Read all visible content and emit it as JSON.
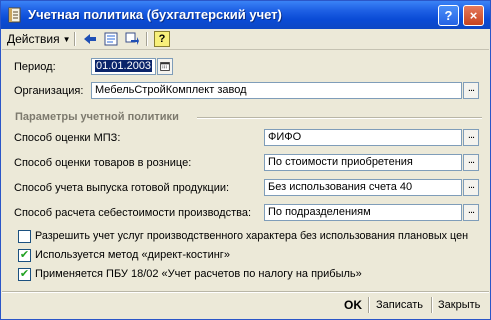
{
  "window": {
    "title": "Учетная политика (бухгалтерский учет)",
    "help_label": "?",
    "close_label": "×"
  },
  "toolbar": {
    "actions_label": "Действия",
    "help_label": "?"
  },
  "form": {
    "period_label": "Период:",
    "period_value": "01.01.2003",
    "org_label": "Организация:",
    "org_value": "МебельСтройКомплект завод",
    "section_title": "Параметры учетной политики",
    "rows": [
      {
        "label": "Способ оценки МПЗ:",
        "value": "ФИФО"
      },
      {
        "label": "Способ оценки товаров в рознице:",
        "value": "По стоимости приобретения"
      },
      {
        "label": "Способ учета выпуска готовой продукции:",
        "value": "Без использования счета 40"
      },
      {
        "label": "Способ расчета себестоимости производства:",
        "value": "По подразделениям"
      }
    ],
    "checkboxes": [
      {
        "label": "Разрешить учет услуг производственного характера без использования плановых цен",
        "checked": false
      },
      {
        "label": "Используется метод «директ-костинг»",
        "checked": true
      },
      {
        "label": "Применяется ПБУ 18/02 «Учет расчетов по налогу на прибыль»",
        "checked": true
      }
    ]
  },
  "buttons": {
    "ok": "OK",
    "save": "Записать",
    "close": "Закрыть"
  },
  "glyphs": {
    "dots": "...",
    "check": "✔"
  },
  "colors": {
    "titlebar": "#0a4bd6",
    "panel": "#ece9d8",
    "selection": "#0a246a"
  }
}
